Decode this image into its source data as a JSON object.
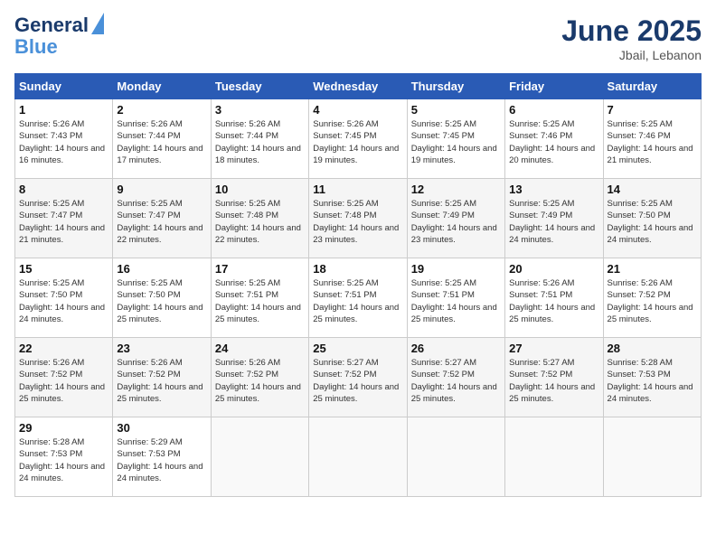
{
  "header": {
    "logo_line1": "General",
    "logo_line2": "Blue",
    "month": "June 2025",
    "location": "Jbail, Lebanon"
  },
  "weekdays": [
    "Sunday",
    "Monday",
    "Tuesday",
    "Wednesday",
    "Thursday",
    "Friday",
    "Saturday"
  ],
  "weeks": [
    [
      {
        "day": "1",
        "sunrise": "5:26 AM",
        "sunset": "7:43 PM",
        "daylight": "14 hours and 16 minutes."
      },
      {
        "day": "2",
        "sunrise": "5:26 AM",
        "sunset": "7:44 PM",
        "daylight": "14 hours and 17 minutes."
      },
      {
        "day": "3",
        "sunrise": "5:26 AM",
        "sunset": "7:44 PM",
        "daylight": "14 hours and 18 minutes."
      },
      {
        "day": "4",
        "sunrise": "5:26 AM",
        "sunset": "7:45 PM",
        "daylight": "14 hours and 19 minutes."
      },
      {
        "day": "5",
        "sunrise": "5:25 AM",
        "sunset": "7:45 PM",
        "daylight": "14 hours and 19 minutes."
      },
      {
        "day": "6",
        "sunrise": "5:25 AM",
        "sunset": "7:46 PM",
        "daylight": "14 hours and 20 minutes."
      },
      {
        "day": "7",
        "sunrise": "5:25 AM",
        "sunset": "7:46 PM",
        "daylight": "14 hours and 21 minutes."
      }
    ],
    [
      {
        "day": "8",
        "sunrise": "5:25 AM",
        "sunset": "7:47 PM",
        "daylight": "14 hours and 21 minutes."
      },
      {
        "day": "9",
        "sunrise": "5:25 AM",
        "sunset": "7:47 PM",
        "daylight": "14 hours and 22 minutes."
      },
      {
        "day": "10",
        "sunrise": "5:25 AM",
        "sunset": "7:48 PM",
        "daylight": "14 hours and 22 minutes."
      },
      {
        "day": "11",
        "sunrise": "5:25 AM",
        "sunset": "7:48 PM",
        "daylight": "14 hours and 23 minutes."
      },
      {
        "day": "12",
        "sunrise": "5:25 AM",
        "sunset": "7:49 PM",
        "daylight": "14 hours and 23 minutes."
      },
      {
        "day": "13",
        "sunrise": "5:25 AM",
        "sunset": "7:49 PM",
        "daylight": "14 hours and 24 minutes."
      },
      {
        "day": "14",
        "sunrise": "5:25 AM",
        "sunset": "7:50 PM",
        "daylight": "14 hours and 24 minutes."
      }
    ],
    [
      {
        "day": "15",
        "sunrise": "5:25 AM",
        "sunset": "7:50 PM",
        "daylight": "14 hours and 24 minutes."
      },
      {
        "day": "16",
        "sunrise": "5:25 AM",
        "sunset": "7:50 PM",
        "daylight": "14 hours and 25 minutes."
      },
      {
        "day": "17",
        "sunrise": "5:25 AM",
        "sunset": "7:51 PM",
        "daylight": "14 hours and 25 minutes."
      },
      {
        "day": "18",
        "sunrise": "5:25 AM",
        "sunset": "7:51 PM",
        "daylight": "14 hours and 25 minutes."
      },
      {
        "day": "19",
        "sunrise": "5:25 AM",
        "sunset": "7:51 PM",
        "daylight": "14 hours and 25 minutes."
      },
      {
        "day": "20",
        "sunrise": "5:26 AM",
        "sunset": "7:51 PM",
        "daylight": "14 hours and 25 minutes."
      },
      {
        "day": "21",
        "sunrise": "5:26 AM",
        "sunset": "7:52 PM",
        "daylight": "14 hours and 25 minutes."
      }
    ],
    [
      {
        "day": "22",
        "sunrise": "5:26 AM",
        "sunset": "7:52 PM",
        "daylight": "14 hours and 25 minutes."
      },
      {
        "day": "23",
        "sunrise": "5:26 AM",
        "sunset": "7:52 PM",
        "daylight": "14 hours and 25 minutes."
      },
      {
        "day": "24",
        "sunrise": "5:26 AM",
        "sunset": "7:52 PM",
        "daylight": "14 hours and 25 minutes."
      },
      {
        "day": "25",
        "sunrise": "5:27 AM",
        "sunset": "7:52 PM",
        "daylight": "14 hours and 25 minutes."
      },
      {
        "day": "26",
        "sunrise": "5:27 AM",
        "sunset": "7:52 PM",
        "daylight": "14 hours and 25 minutes."
      },
      {
        "day": "27",
        "sunrise": "5:27 AM",
        "sunset": "7:52 PM",
        "daylight": "14 hours and 25 minutes."
      },
      {
        "day": "28",
        "sunrise": "5:28 AM",
        "sunset": "7:53 PM",
        "daylight": "14 hours and 24 minutes."
      }
    ],
    [
      {
        "day": "29",
        "sunrise": "5:28 AM",
        "sunset": "7:53 PM",
        "daylight": "14 hours and 24 minutes."
      },
      {
        "day": "30",
        "sunrise": "5:29 AM",
        "sunset": "7:53 PM",
        "daylight": "14 hours and 24 minutes."
      },
      null,
      null,
      null,
      null,
      null
    ]
  ],
  "labels": {
    "sunrise": "Sunrise:",
    "sunset": "Sunset:",
    "daylight": "Daylight:"
  }
}
